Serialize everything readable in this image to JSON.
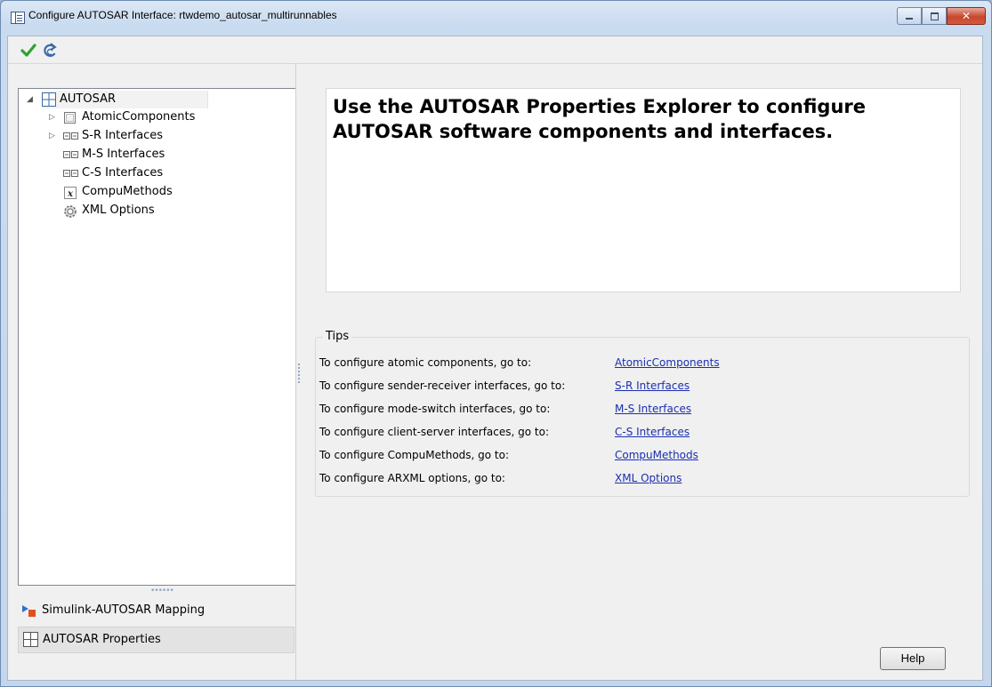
{
  "window": {
    "title": "Configure AUTOSAR Interface: rtwdemo_autosar_multirunnables"
  },
  "toolbar": {
    "apply_icon": "checkmark-icon",
    "refresh_icon": "refresh-icon"
  },
  "tree": {
    "root": {
      "label": "AUTOSAR",
      "icon": "autosar-grid-icon",
      "expanded": true
    },
    "children": [
      {
        "label": "AtomicComponents",
        "icon": "component-icon",
        "expandable": true
      },
      {
        "label": "S-R Interfaces",
        "icon": "interface-icon",
        "expandable": true
      },
      {
        "label": "M-S Interfaces",
        "icon": "interface-icon",
        "expandable": false
      },
      {
        "label": "C-S Interfaces",
        "icon": "interface-icon",
        "expandable": false
      },
      {
        "label": "CompuMethods",
        "icon": "function-icon",
        "expandable": false
      },
      {
        "label": "XML Options",
        "icon": "gear-icon",
        "expandable": false
      }
    ]
  },
  "nav": {
    "mapping_label": "Simulink-AUTOSAR Mapping",
    "properties_label": "AUTOSAR Properties"
  },
  "main": {
    "header_text": "Use the AUTOSAR Properties Explorer to configure AUTOSAR software components and interfaces.",
    "tips_title": "Tips",
    "tips": [
      {
        "text": "To configure atomic components, go to:",
        "link": "AtomicComponents"
      },
      {
        "text": "To configure sender-receiver interfaces, go to:",
        "link": "S-R Interfaces"
      },
      {
        "text": "To configure mode-switch interfaces, go to:",
        "link": "M-S Interfaces"
      },
      {
        "text": "To configure client-server interfaces, go to:",
        "link": "C-S Interfaces"
      },
      {
        "text": "To configure CompuMethods, go to:",
        "link": "CompuMethods"
      },
      {
        "text": "To configure ARXML options, go to:",
        "link": "XML Options"
      }
    ]
  },
  "buttons": {
    "help_label": "Help"
  },
  "colors": {
    "link": "#1a2fb0",
    "title_bar": "#c9dbef",
    "close_button": "#c6472e"
  }
}
